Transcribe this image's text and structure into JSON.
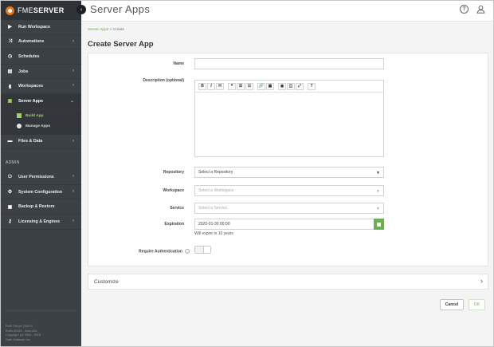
{
  "brand": {
    "prefix": "FME",
    "suffix": "SERVER"
  },
  "header": {
    "title": "Server Apps"
  },
  "sidebar": {
    "items": [
      {
        "label": "Run Workspace",
        "icon": "play-icon"
      },
      {
        "label": "Automations",
        "icon": "shuffle-icon"
      },
      {
        "label": "Schedules",
        "icon": "clock-icon"
      },
      {
        "label": "Jobs",
        "icon": "list-icon"
      },
      {
        "label": "Workspaces",
        "icon": "file-icon"
      },
      {
        "label": "Server Apps",
        "icon": "app-icon"
      },
      {
        "label": "Files & Data",
        "icon": "folder-icon"
      }
    ],
    "sub_items": [
      {
        "label": "Build App"
      },
      {
        "label": "Manage Apps"
      }
    ],
    "admin_label": "ADMIN",
    "admin_items": [
      {
        "label": "User Permissions",
        "icon": "users-icon"
      },
      {
        "label": "System Configuration",
        "icon": "gear-icon"
      },
      {
        "label": "Backup & Restore",
        "icon": "save-icon"
      },
      {
        "label": "Licensing & Engines",
        "icon": "key-icon"
      }
    ],
    "footer": {
      "line1": "FME Server 2020.0",
      "line2": "Build 20194 - linux-x64",
      "line3": "Copyright (c) 1994 - 2019",
      "line4": "Safe Software Inc."
    }
  },
  "breadcrumb": {
    "parent": "Server Apps",
    "separator": ">",
    "current": "Create"
  },
  "main": {
    "title": "Create Server App"
  },
  "form": {
    "name_label": "Name",
    "name_value": "",
    "description_label": "Description (optional)",
    "toolbar": [
      "B",
      "I",
      "H",
      "❝",
      "☰",
      "☷",
      "🔗",
      "▣",
      "◉",
      "◫",
      "⤢",
      "?"
    ],
    "repository_label": "Repository",
    "repository_value": "Select a Repository",
    "workspace_label": "Workspace",
    "workspace_value": "Select a Workspace",
    "service_label": "Service",
    "service_value": "Select a Service",
    "expiration_label": "Expiration",
    "expiration_value": "2020-01-30 00:00",
    "expiration_hint": "Will expire in 10 years",
    "auth_label": "Require Authentication",
    "auth_enabled": false
  },
  "customize": {
    "label": "Customize"
  },
  "buttons": {
    "cancel": "Cancel",
    "ok": "OK"
  },
  "colors": {
    "accent_green": "#6ab04c",
    "sidebar_bg": "#3c4146",
    "brand_orange": "#e8741c"
  }
}
